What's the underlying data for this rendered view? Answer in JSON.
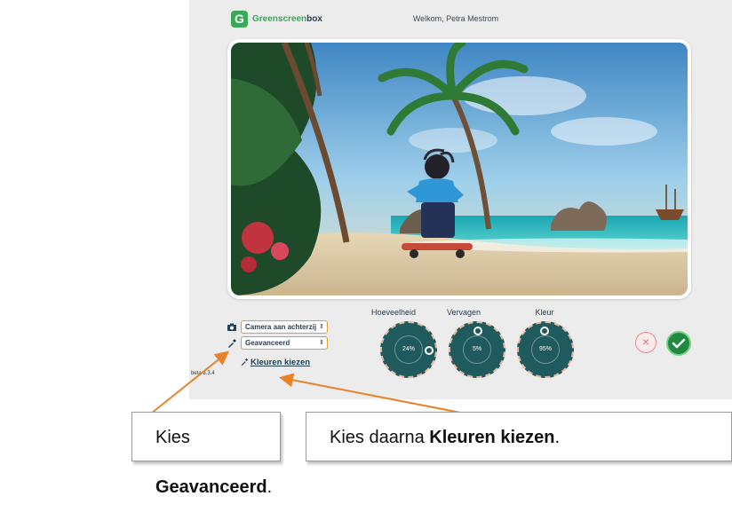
{
  "header": {
    "logo_letter": "G",
    "logo_part1": "Greenscreen",
    "logo_part2": "box",
    "welcome": "Welkom, Petra Mestrom"
  },
  "controls": {
    "camera_select": "Camera aan achterzij",
    "mode_select": "Geavanceerd",
    "colors_link": "Kleuren kiezen",
    "version": "beta 6.3.4"
  },
  "dials": [
    {
      "label": "Hoeveelheid",
      "value": "24%"
    },
    {
      "label": "Vervagen",
      "value": "5%"
    },
    {
      "label": "Kleur",
      "value": "95%"
    }
  ],
  "actions": {
    "cancel_symbol": "×"
  },
  "captions": {
    "left_prefix": "Kies ",
    "left_bold": "Geavanceerd",
    "left_suffix": ".",
    "right_prefix": "Kies daarna ",
    "right_bold": "Kleuren kiezen",
    "right_suffix": "."
  },
  "colors": {
    "brand_green": "#3aa957",
    "dial_teal": "#1f5a5e",
    "select_border": "#d9a13a",
    "arrow_orange": "#e8822a",
    "confirm_green": "#1e8a3f"
  }
}
